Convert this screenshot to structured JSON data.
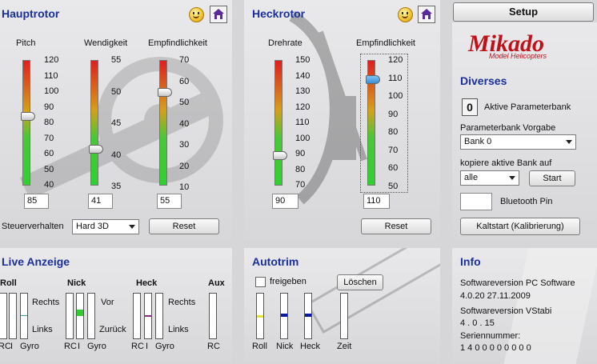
{
  "setup_label": "Setup",
  "logo": {
    "brand": "Mikado",
    "tagline": "Model Helicopters"
  },
  "hauptrotor": {
    "title": "Hauptrotor",
    "pitch": {
      "label": "Pitch",
      "scale": [
        "120",
        "110",
        "100",
        "90",
        "80",
        "70",
        "60",
        "50",
        "40"
      ],
      "value": "85",
      "level": 0.56
    },
    "wendigkeit": {
      "label": "Wendigkeit",
      "scale": [
        "55",
        "50",
        "45",
        "40",
        "35"
      ],
      "value": "41",
      "level": 0.3
    },
    "empfindlichkeit": {
      "label": "Empfindlichkeit",
      "scale": [
        "70",
        "60",
        "50",
        "40",
        "30",
        "20",
        "10"
      ],
      "value": "55",
      "level": 0.75
    },
    "steuerverhalten_label": "Steuerverhalten",
    "steuerverhalten_value": "Hard 3D",
    "reset_label": "Reset"
  },
  "heckrotor": {
    "title": "Heckrotor",
    "drehrate": {
      "label": "Drehrate",
      "scale": [
        "150",
        "140",
        "130",
        "120",
        "110",
        "100",
        "90",
        "80",
        "70"
      ],
      "value": "90",
      "level": 0.25
    },
    "empfindlichkeit": {
      "label": "Empfindlichkeit",
      "scale": [
        "120",
        "110",
        "100",
        "90",
        "80",
        "70",
        "60",
        "50"
      ],
      "value": "110",
      "level": 0.86
    },
    "reset_label": "Reset"
  },
  "diverse": {
    "title": "Diverses",
    "aktive_bank_value": "0",
    "aktive_bank_label": "Aktive Parameterbank",
    "vorgabe_label": "Parameterbank Vorgabe",
    "vorgabe_value": "Bank 0",
    "kopiere_label": "kopiere aktive Bank auf",
    "kopiere_value": "alle",
    "start_label": "Start",
    "bluetooth_label": "Bluetooth Pin",
    "kaltstart_label": "Kaltstart (Kalibrierung)"
  },
  "live": {
    "title": "Live Anzeige",
    "roll": "Roll",
    "nick": "Nick",
    "heck": "Heck",
    "aux": "Aux",
    "rechts": "Rechts",
    "links": "Links",
    "vor": "Vor",
    "zurueck": "Zurück",
    "rc": "RC",
    "i": "I",
    "gyro": "Gyro"
  },
  "autotrim": {
    "title": "Autotrim",
    "freigeben_label": "freigeben",
    "loeschen_label": "Löschen",
    "roll": "Roll",
    "nick": "Nick",
    "heck": "Heck",
    "zeit": "Zeit"
  },
  "info": {
    "title": "Info",
    "sw_pc_label": "Softwareversion PC Software",
    "sw_pc_value": "4.0.20  27.11.2009",
    "sw_vstabi_label": "Softwareversion VStabi",
    "sw_vstabi_value": "4 . 0 . 15",
    "serial_label": "Seriennummer:",
    "serial_value": "1 4 0 0 0 0 0 0 0 0"
  },
  "colors": {
    "title": "#1a2f9a",
    "logo": "#c0101a",
    "live_green": "#2ecc2e",
    "live_yellow": "#e8e030",
    "marker_blue": "#0a1aa0",
    "marker_purple": "#8a2a8a"
  }
}
